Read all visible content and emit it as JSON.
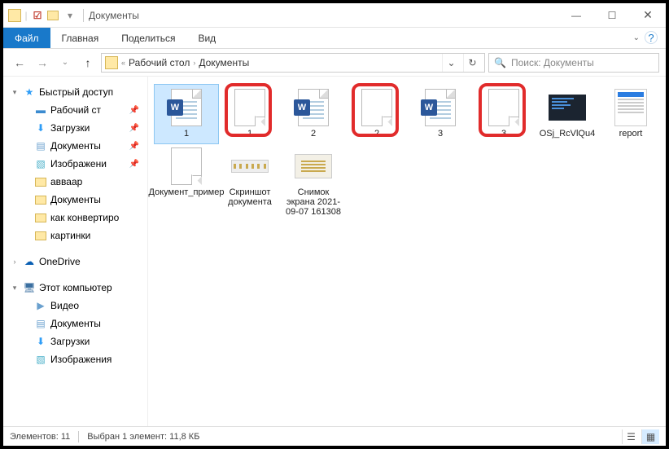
{
  "window": {
    "title": "Документы",
    "min": "—",
    "max": "☐",
    "close": "✕"
  },
  "ribbon": {
    "file": "Файл",
    "tabs": [
      "Главная",
      "Поделиться",
      "Вид"
    ],
    "expand": "⌄",
    "help": "?"
  },
  "nav": {
    "back": "←",
    "forward": "→",
    "recent": "⌄",
    "up": "↑"
  },
  "address": {
    "overflow": "«",
    "crumbs": [
      "Рабочий стол",
      "Документы"
    ],
    "sep": "›",
    "dropdown": "⌄",
    "refresh": "↻"
  },
  "search": {
    "icon": "🔍",
    "placeholder": "Поиск: Документы"
  },
  "sidebar": {
    "quick": {
      "label": "Быстрый доступ",
      "twisty": "▾"
    },
    "items": [
      {
        "label": "Рабочий ст",
        "icon": "desktop",
        "pinned": true
      },
      {
        "label": "Загрузки",
        "icon": "downloads",
        "pinned": true
      },
      {
        "label": "Документы",
        "icon": "documents",
        "pinned": true
      },
      {
        "label": "Изображени",
        "icon": "pictures",
        "pinned": true
      },
      {
        "label": "авваар",
        "icon": "folder",
        "pinned": false
      },
      {
        "label": "Документы",
        "icon": "folder",
        "pinned": false
      },
      {
        "label": "как конвертиро",
        "icon": "folder",
        "pinned": false
      },
      {
        "label": "картинки",
        "icon": "folder",
        "pinned": false
      }
    ],
    "onedrive": {
      "label": "OneDrive",
      "twisty": "›"
    },
    "thispc": {
      "label": "Этот компьютер",
      "twisty": "▾"
    },
    "pcitems": [
      {
        "label": "Видео",
        "icon": "video"
      },
      {
        "label": "Документы",
        "icon": "documents"
      },
      {
        "label": "Загрузки",
        "icon": "downloads"
      },
      {
        "label": "Изображения",
        "icon": "pictures"
      }
    ]
  },
  "files": [
    {
      "name": "1",
      "type": "word",
      "selected": true
    },
    {
      "name": "1",
      "type": "blank",
      "ring": true
    },
    {
      "name": "2",
      "type": "word"
    },
    {
      "name": "2",
      "type": "blank",
      "ring": true
    },
    {
      "name": "3",
      "type": "word"
    },
    {
      "name": "3",
      "type": "blank",
      "ring": true
    },
    {
      "name": "OSj_RcVlQu4",
      "type": "dark"
    },
    {
      "name": "report",
      "type": "report"
    },
    {
      "name": "Документ_пример",
      "type": "blank"
    },
    {
      "name": "Скриншот документа",
      "type": "screenshot"
    },
    {
      "name": "Снимок экрана 2021-09-07 161308",
      "type": "screenshot2"
    }
  ],
  "status": {
    "count": "Элементов: 11",
    "selection": "Выбран 1 элемент: 11,8 КБ"
  }
}
